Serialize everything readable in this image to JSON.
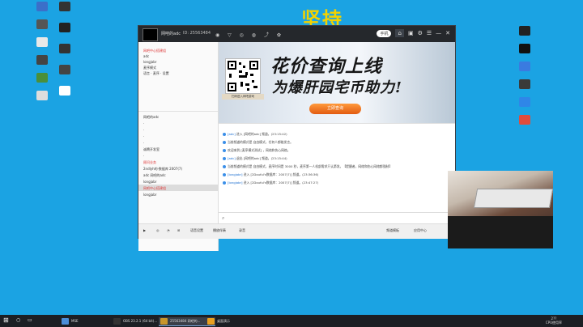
{
  "watermark": "坚持",
  "desktop_icons_left": [
    {
      "label": "",
      "color": "#3b6fc9"
    },
    {
      "label": "",
      "color": "#555"
    },
    {
      "label": "",
      "color": "#e8e8e8"
    },
    {
      "label": "",
      "color": "#444"
    },
    {
      "label": "",
      "color": "#4a8f3a"
    },
    {
      "label": "",
      "color": "#ddd"
    }
  ],
  "desktop_icons_left2": [
    {
      "label": "",
      "color": "#333"
    },
    {
      "label": "",
      "color": "#222"
    },
    {
      "label": "",
      "color": "#333"
    },
    {
      "label": "",
      "color": "#444"
    },
    {
      "label": "",
      "color": "#fff"
    }
  ],
  "desktop_icons_right": [
    {
      "label": "",
      "color": "#222"
    },
    {
      "label": "",
      "color": "#111"
    },
    {
      "label": "",
      "color": "#3a7be0"
    },
    {
      "label": "",
      "color": "#3a3a3a"
    },
    {
      "label": "",
      "color": "#2f86e8"
    },
    {
      "label": "",
      "color": "#e04c3c"
    }
  ],
  "window": {
    "nickname": "网吧的adc",
    "room_id": "ID: 25563484",
    "title_glyphs": "◉ ▽ ◎ ◍ ⤴ ✿",
    "pill": "手机",
    "controls": [
      "⌂",
      "▣",
      "⚙",
      "☰",
      "—",
      "✕"
    ]
  },
  "sidebar": {
    "rows": [
      {
        "text": "网吧中心搭建组",
        "style": "red"
      },
      {
        "text": "adc",
        "style": ""
      },
      {
        "text": "longjabr",
        "style": ""
      },
      {
        "text": "麦序模式",
        "style": ""
      },
      {
        "text": "语言 · 麦序 · 设置",
        "style": ""
      }
    ],
    "lower_rows": [
      {
        "text": "网吧的adc",
        "style": ""
      },
      {
        "text": "·",
        "style": ""
      },
      {
        "text": "·",
        "style": ""
      },
      {
        "text": "·",
        "style": ""
      },
      {
        "text": "·",
        "style": ""
      },
      {
        "text": "诚聘开发室",
        "style": ""
      },
      {
        "text": "·",
        "style": ""
      },
      {
        "text": "顾问业务",
        "style": "red"
      },
      {
        "text": "2ndlyh的·数据库 2007(7)",
        "style": ""
      },
      {
        "text": "adc 网吧的adc",
        "style": ""
      },
      {
        "text": "longjabr",
        "style": ""
      },
      {
        "text": "网吧中心搭建组",
        "style": "red"
      },
      {
        "text": "longjabr",
        "style": ""
      }
    ]
  },
  "banner": {
    "title1": "花价查询上线",
    "title2": "为爆肝园宅币助力!",
    "button": "立即查询",
    "qr_caption": "扫码进入网吧游戏"
  },
  "chat": {
    "messages": [
      {
        "user": "[adc]",
        "text": "进入 [网吧的adc] 频道。(23:15:42)"
      },
      {
        "user": "",
        "text": "当前频道的模式是 自由模式，任何人都能发言。"
      },
      {
        "user": "",
        "text": "欢迎来到 [麦序模式测试] ，网络和伤心网络。"
      },
      {
        "user": "[adc]",
        "text": "退出 [网吧的adc] 频道。(23:15:44)"
      },
      {
        "user": "",
        "text": "当前频道的模式是 自由模式，麦序时间是 3000 秒，麦序第一人机部需求只认第发。【提醒者，网络和伤心网络都强制】"
      },
      {
        "user": "[longjabr]",
        "text": "进入 [2Douful's数据库：2007(7)] 频道。(23:36:36)"
      },
      {
        "user": "[longjabr]",
        "text": "进入 [2Douful's数据库：2007(7)] 频道。(23:47:27)"
      }
    ]
  },
  "bottom_bar": {
    "items": [
      "▶",
      "◎",
      "◔",
      "⊞",
      "语音设置",
      "播放伴奏",
      "录音"
    ],
    "right_items": [
      "频道模板",
      "应用中心"
    ]
  },
  "taskbar": {
    "items": [
      {
        "label": "MSE",
        "color": "#4b8ed8"
      },
      {
        "label": "OBS 23.2.1 (64 bit)...",
        "color": "#333"
      },
      {
        "label": "25563484 网吧的...",
        "color": "#c8962c"
      },
      {
        "label": "桌面演示",
        "color": "#e8a020"
      }
    ],
    "clock_time": "2??",
    "clock_date": "CPU使用率"
  }
}
